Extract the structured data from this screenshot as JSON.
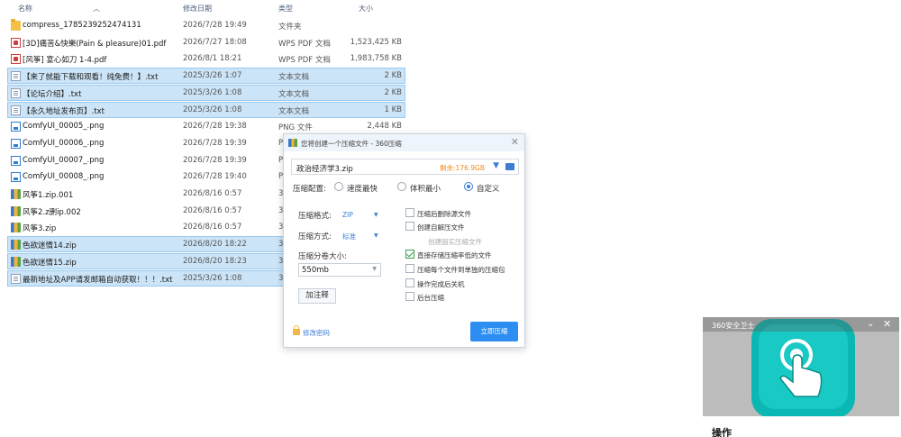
{
  "columns": {
    "name": "名称",
    "date": "修改日期",
    "type": "类型",
    "size": "大小"
  },
  "files": [
    {
      "name": "compress_1785239252474131",
      "date": "2026/7/28 19:49",
      "type": "文件夹",
      "size": "",
      "icon": "folder-icon",
      "selected": false
    },
    {
      "name": "[3D]痛苦&快樂(Pain & pleasure)01.pdf",
      "date": "2026/7/27 18:08",
      "type": "WPS PDF 文档",
      "size": "1,523,425 KB",
      "icon": "pdf-icon",
      "selected": false
    },
    {
      "name": "[风筝] 宴心如刀 1-4.pdf",
      "date": "2026/8/1 18:21",
      "type": "WPS PDF 文档",
      "size": "1,983,758 KB",
      "icon": "pdf-icon",
      "selected": false
    },
    {
      "name": "【来了就能下载和观看！纯免费！】.txt",
      "date": "2025/3/26 1:07",
      "type": "文本文档",
      "size": "2 KB",
      "icon": "txt-icon",
      "selected": true
    },
    {
      "name": "【论坛介绍】.txt",
      "date": "2025/3/26 1:08",
      "type": "文本文档",
      "size": "2 KB",
      "icon": "txt-icon",
      "selected": true
    },
    {
      "name": "【永久地址发布页】.txt",
      "date": "2025/3/26 1:08",
      "type": "文本文档",
      "size": "1 KB",
      "icon": "txt-icon",
      "selected": true
    },
    {
      "name": "ComfyUI_00005_.png",
      "date": "2026/7/28 19:38",
      "type": "PNG 文件",
      "size": "2,448 KB",
      "icon": "png-icon",
      "selected": false
    },
    {
      "name": "ComfyUI_00006_.png",
      "date": "2026/7/28 19:39",
      "type": "P",
      "size": "",
      "icon": "png-icon",
      "selected": false
    },
    {
      "name": "ComfyUI_00007_.png",
      "date": "2026/7/28 19:39",
      "type": "P",
      "size": "",
      "icon": "png-icon",
      "selected": false
    },
    {
      "name": "ComfyUI_00008_.png",
      "date": "2026/7/28 19:40",
      "type": "P",
      "size": "",
      "icon": "png-icon",
      "selected": false
    },
    {
      "name": "风筝1.zip.001",
      "date": "2026/8/16 0:57",
      "type": "3",
      "size": "",
      "icon": "archive-icon",
      "selected": false
    },
    {
      "name": "风筝2.z删ip.002",
      "date": "2026/8/16 0:57",
      "type": "3",
      "size": "",
      "icon": "archive-icon",
      "selected": false
    },
    {
      "name": "风筝3.zip",
      "date": "2026/8/16 0:57",
      "type": "3",
      "size": "",
      "icon": "archive-icon",
      "selected": false
    },
    {
      "name": "色欲迷情14.zip",
      "date": "2026/8/20 18:22",
      "type": "3",
      "size": "",
      "icon": "archive-icon",
      "selected": true
    },
    {
      "name": "色欲迷情15.zip",
      "date": "2026/8/20 18:23",
      "type": "3",
      "size": "",
      "icon": "archive-icon",
      "selected": true
    },
    {
      "name": "最新地址及APP请发邮箱自动获取！！！.txt",
      "date": "2025/3/26 1:08",
      "type": "3",
      "size": "",
      "icon": "txt-icon",
      "selected": true
    }
  ],
  "dialog": {
    "title": "您将创建一个压缩文件 - 360压缩",
    "filename": "政治经济学3.zip",
    "free_space": "剩余:176.9GB",
    "config_label": "压缩配置:",
    "radio_options": [
      {
        "label": "速度最快",
        "selected": false
      },
      {
        "label": "体积最小",
        "selected": false
      },
      {
        "label": "自定义",
        "selected": true
      }
    ],
    "format_label": "压缩格式:",
    "format_value": "ZIP",
    "method_label": "压缩方式:",
    "method_value": "标准",
    "split_label": "压缩分卷大小:",
    "split_value": "550mb",
    "comment_button": "加注释",
    "checkboxes": [
      {
        "label": "压缩后删除源文件",
        "checked": false,
        "disabled": false
      },
      {
        "label": "创建自解压文件",
        "checked": false,
        "disabled": false
      },
      {
        "label": "创建固实压缩文件",
        "checked": false,
        "disabled": true
      },
      {
        "label": "直接存储压缩率低的文件",
        "checked": true,
        "disabled": false
      },
      {
        "label": "压缩每个文件到单独的压缩包",
        "checked": false,
        "disabled": false
      },
      {
        "label": "操作完成后关机",
        "checked": false,
        "disabled": false
      },
      {
        "label": "后台压缩",
        "checked": false,
        "disabled": false
      }
    ],
    "password_link": "修改密码",
    "start_button": "立即压缩"
  },
  "popup": {
    "brand": "360安全卫士",
    "caption": "操作"
  }
}
